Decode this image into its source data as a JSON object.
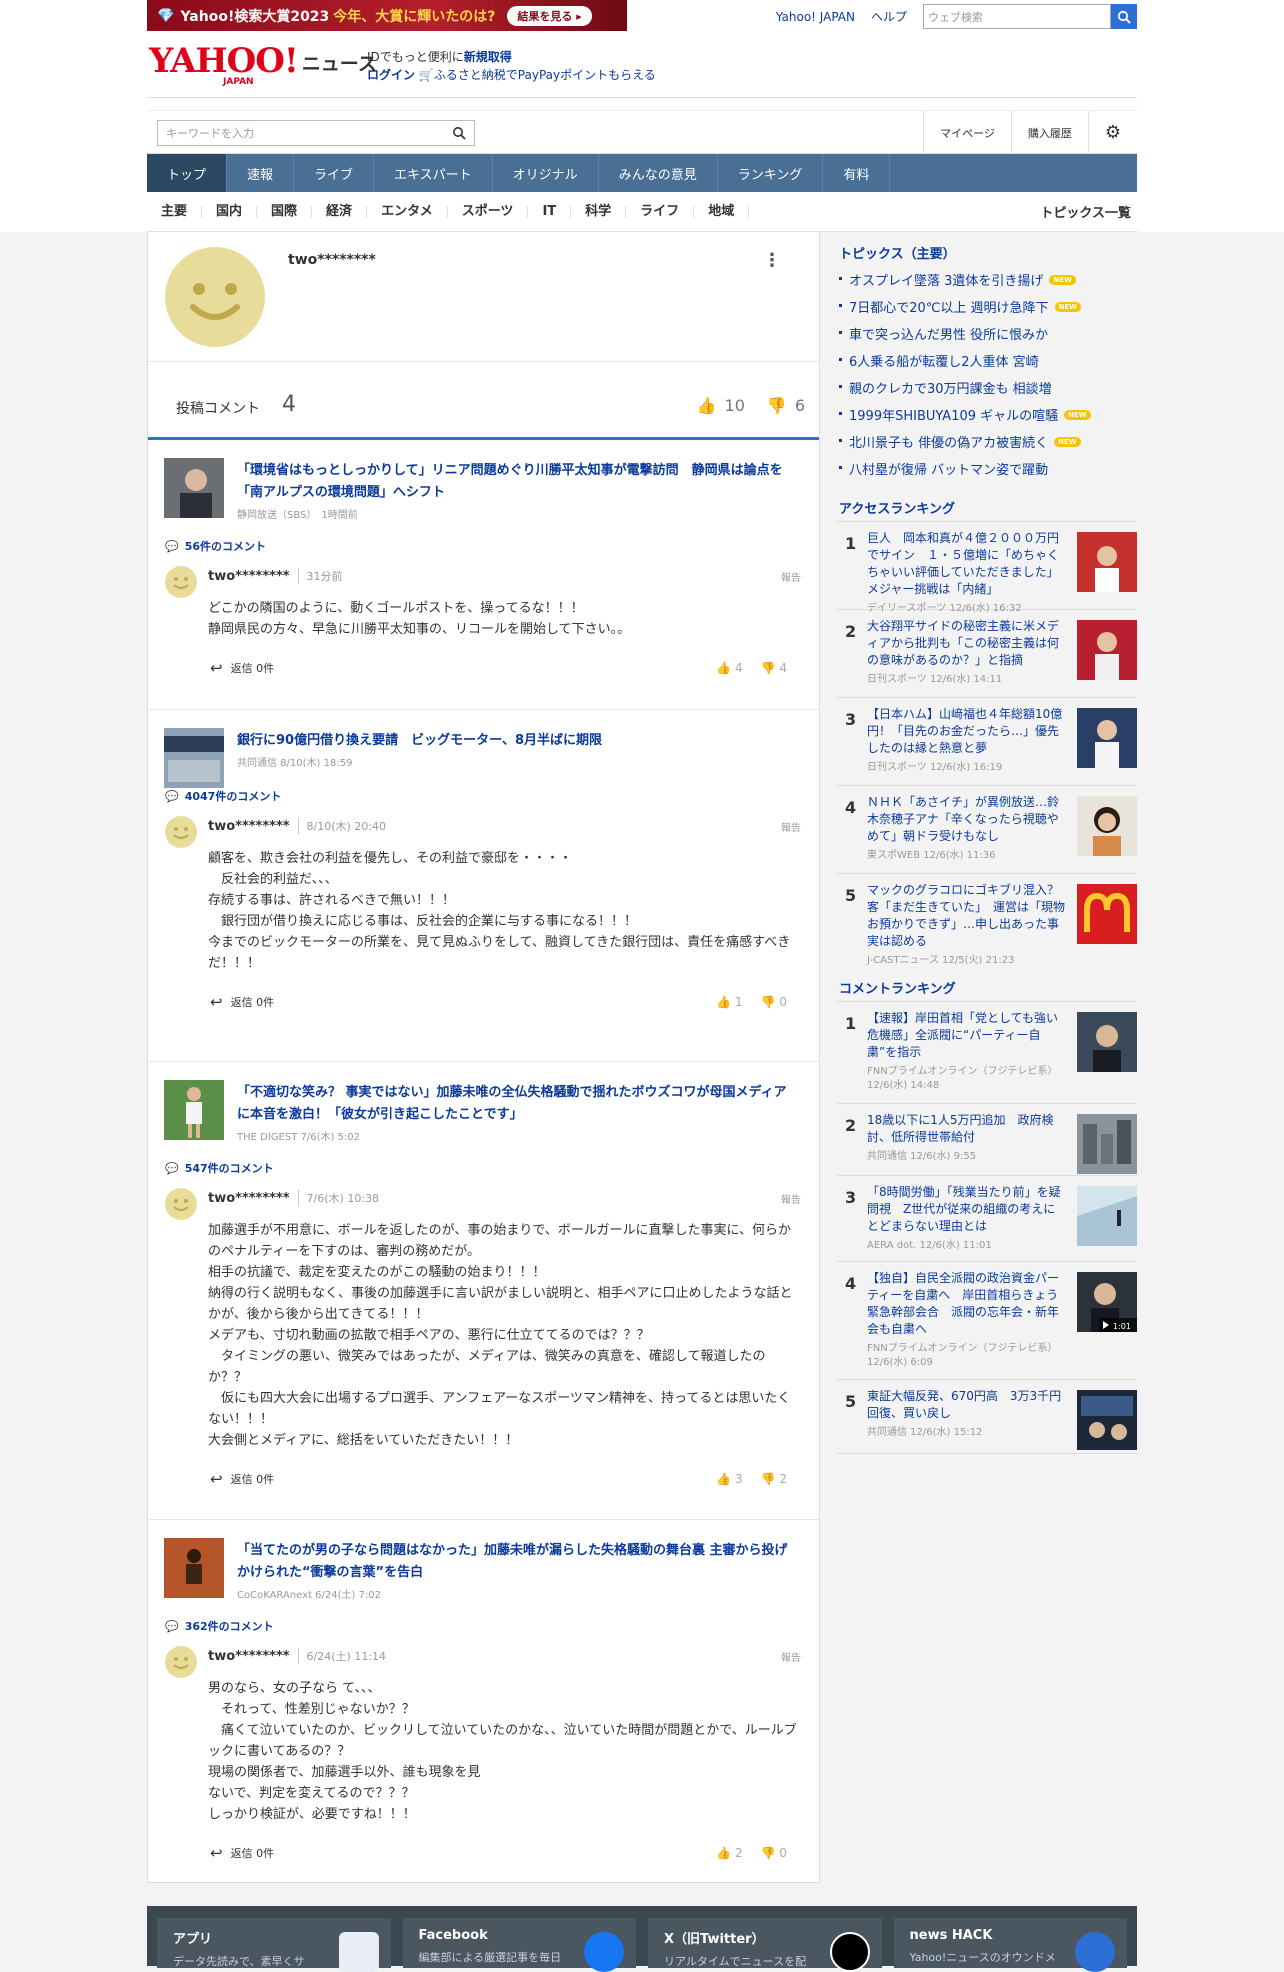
{
  "topbar": {
    "banner_main": "Yahoo!検索大賞2023",
    "banner_highlight": "今年、大賞に輝いたのは?",
    "banner_button": "結果を見る",
    "yahoo_japan": "Yahoo! JAPAN",
    "help": "ヘルプ",
    "web_search_placeholder": "ウェブ検索"
  },
  "header": {
    "logo": "YAHOO!",
    "logo_sub": "JAPAN",
    "section": "ニュース",
    "id_text": "IDでもっと便利に",
    "register": "新規取得",
    "login": "ログイン",
    "furusato": "ふるさと納税でPayPayポイントもらえる"
  },
  "search": {
    "placeholder": "キーワードを入力",
    "mypage": "マイページ",
    "history": "購入履歴"
  },
  "nav": [
    "トップ",
    "速報",
    "ライブ",
    "エキスパート",
    "オリジナル",
    "みんなの意見",
    "ランキング",
    "有料"
  ],
  "subnav": [
    "主要",
    "国内",
    "国際",
    "経済",
    "エンタメ",
    "スポーツ",
    "IT",
    "科学",
    "ライフ",
    "地域"
  ],
  "subnav_all": "トピックス一覧",
  "profile": {
    "username": "two********",
    "stats_label": "投稿コメント",
    "comment_count": "4",
    "likes": "10",
    "dislikes": "6"
  },
  "labels": {
    "report": "報告",
    "reply_prefix": "返信"
  },
  "comments": [
    {
      "article_title": "「環境省はもっとしっかりして」リニア問題めぐり川勝平太知事が電撃訪問　静岡県は論点を「南アルプスの環境問題」へシフト",
      "article_source": "静岡放送（SBS）　1時間前",
      "comment_count": "56件のコメント",
      "user": "two********",
      "time": "31分前",
      "text": "どこかの隣国のように、動くゴールポストを、操ってるな！！！\n静岡県民の方々、早急に川勝平太知事の、リコールを開始して下さい。。",
      "replies": "返信 0件",
      "up": "4",
      "down": "4"
    },
    {
      "article_title": "銀行に90億円借り換え要請　ビッグモーター、8月半ばに期限",
      "article_source": "共同通信 8/10(木) 18:59",
      "comment_count": "4047件のコメント",
      "user": "two********",
      "time": "8/10(木) 20:40",
      "text": "顧客を、欺き会社の利益を優先し、その利益で豪邸を・・・・\n　反社会的利益だ、、、\n存続する事は、許されるべきで無い！！！\n　銀行団が借り換えに応じる事は、反社会的企業に与する事になる！！！\n今までのビックモーターの所業を、見て見ぬふりをして、融資してきた銀行団は、責任を痛感すべきだ！！！",
      "replies": "返信 0件",
      "up": "1",
      "down": "0"
    },
    {
      "article_title": "「不適切な笑み？ 事実ではない」加藤未唯の全仏失格騒動で揺れたボウズコワが母国メディアに本音を激白！「彼女が引き起こしたことです」",
      "article_source": "THE DIGEST 7/6(木) 5:02",
      "comment_count": "547件のコメント",
      "user": "two********",
      "time": "7/6(木) 10:38",
      "text": "加藤選手が不用意に、ボールを返したのが、事の始まりで、ボールガールに直撃した事実に、何らかのペナルティーを下すのは、審判の務めだが。\n相手の抗議で、裁定を変えたのがこの騒動の始まり！！！\n納得の行く説明もなく、事後の加藤選手に言い訳がましい説明と、相手ペアに口止めしたような話とかが、後から後から出てきてる！！！\nメデアも、寸切れ動画の拡散で相手ペアの、悪行に仕立ててるのでは？？？\n　タイミングの悪い、微笑みではあったが、メディアは、微笑みの真意を、確認して報道したのか？？\n　仮にも四大大会に出場するプロ選手、アンフェアーなスポーツマン精神を、持ってるとは思いたくない！！！\n大会側とメディアに、総括をいていただきたい！！！",
      "replies": "返信 0件",
      "up": "3",
      "down": "2"
    },
    {
      "article_title": "「当てたのが男の子なら問題はなかった」加藤未唯が漏らした失格騒動の舞台裏 主審から投げかけられた“衝撃の言葉”を告白",
      "article_source": "CoCoKARAnext 6/24(土) 7:02",
      "comment_count": "362件のコメント",
      "user": "two********",
      "time": "6/24(土) 11:14",
      "text": "男のなら、女の子なら て、、、\n　それって、性差別じゃないか？？\n　痛くて泣いていたのか、ビックリして泣いていたのかな、、泣いていた時間が問題とかで、ルールブックに書いてあるの？？\n現場の関係者で、加藤選手以外、誰も現象を見\nないで、判定を変えてるので？？？\nしっかり検証が、必要ですね！！！",
      "replies": "返信 0件",
      "up": "2",
      "down": "0"
    }
  ],
  "sidebar": {
    "topics_title": "トピックス（主要）",
    "topics": [
      {
        "text": "オスプレイ墜落 3遺体を引き揚げ",
        "new": "NEW"
      },
      {
        "text": "7日都心で20℃以上 週明け急降下",
        "new": "NEW"
      },
      {
        "text": "車で突っ込んだ男性 役所に恨みか",
        "new": ""
      },
      {
        "text": "6人乗る船が転覆し2人重体 宮崎",
        "new": ""
      },
      {
        "text": "親のクレカで30万円課金も 相談増",
        "new": ""
      },
      {
        "text": "1999年SHIBUYA109 ギャルの喧騒",
        "new": "NEW"
      },
      {
        "text": "北川景子も 俳優の偽アカ被害続く",
        "new": "NEW"
      },
      {
        "text": "八村塁が復帰 バットマン姿で躍動",
        "new": ""
      }
    ],
    "access_title": "アクセスランキング",
    "access": [
      {
        "no": "1",
        "title": "巨人　岡本和真が４億２０００万円でサイン　１・５億増に「めちゃくちゃいい評価していただきました」メジャー挑戦は「内緒」",
        "src": "デイリースポーツ 12/6(水) 16:32"
      },
      {
        "no": "2",
        "title": "大谷翔平サイドの秘密主義に米メディアから批判も「この秘密主義は何の意味があるのか？」と指摘",
        "src": "日刊スポーツ 12/6(水) 14:11"
      },
      {
        "no": "3",
        "title": "【日本ハム】山﨑福也４年総額10億円！「目先のお金だったら…」優先したのは縁と熱意と夢",
        "src": "日刊スポーツ 12/6(水) 16:19"
      },
      {
        "no": "4",
        "title": "ＮＨＫ「あさイチ」が異例放送…鈴木奈穂子アナ「辛くなったら視聴やめて」朝ドラ受けもなし",
        "src": "東スポWEB 12/6(水) 11:36"
      },
      {
        "no": "5",
        "title": "マックのグラコロにゴキブリ混入？客「まだ生きていた」　運営は「現物お預かりできず」…申し出あった事実は認める",
        "src": "J-CASTニュース 12/5(火) 21:23"
      }
    ],
    "comment_title": "コメントランキング",
    "comment_rank": [
      {
        "no": "1",
        "title": "【速報】岸田首相「党としても強い危機感」全派閥に“パーティー自粛”を指示",
        "src": "FNNプライムオンライン（フジテレビ系） 12/6(水) 14:48"
      },
      {
        "no": "2",
        "title": "18歳以下に1人5万円追加　政府検討、低所得世帯給付",
        "src": "共同通信 12/6(水) 9:55"
      },
      {
        "no": "3",
        "title": "「8時間労働」「残業当たり前」を疑問視　Z世代が従来の組織の考えにとどまらない理由とは",
        "src": "AERA dot. 12/6(水) 11:01"
      },
      {
        "no": "4",
        "title": "【独自】自民全派閥の政治資金パーティーを自粛へ　岸田首相らきょう緊急幹部会合　派閥の忘年会・新年会も自粛へ",
        "src": "FNNプライムオンライン（フジテレビ系） 12/6(水) 6:09"
      },
      {
        "no": "5",
        "title": "東証大幅反発、670円高　3万3千円回復、買い戻し",
        "src": "共同通信 12/6(水) 15:12"
      }
    ],
    "video_time": "1:01"
  },
  "footer": [
    {
      "title": "アプリ",
      "sub": "データ先読みで、素早くサ"
    },
    {
      "title": "Facebook",
      "sub": "編集部による厳選記事を毎日"
    },
    {
      "title": "X（旧Twitter）",
      "sub": "リアルタイムでニュースを配"
    },
    {
      "title": "news HACK",
      "sub": "Yahoo!ニュースのオウンドメ"
    }
  ],
  "colors": {
    "accent": "#0b3a9c",
    "nav": "#4a6f95",
    "brand": "#e1001a"
  }
}
